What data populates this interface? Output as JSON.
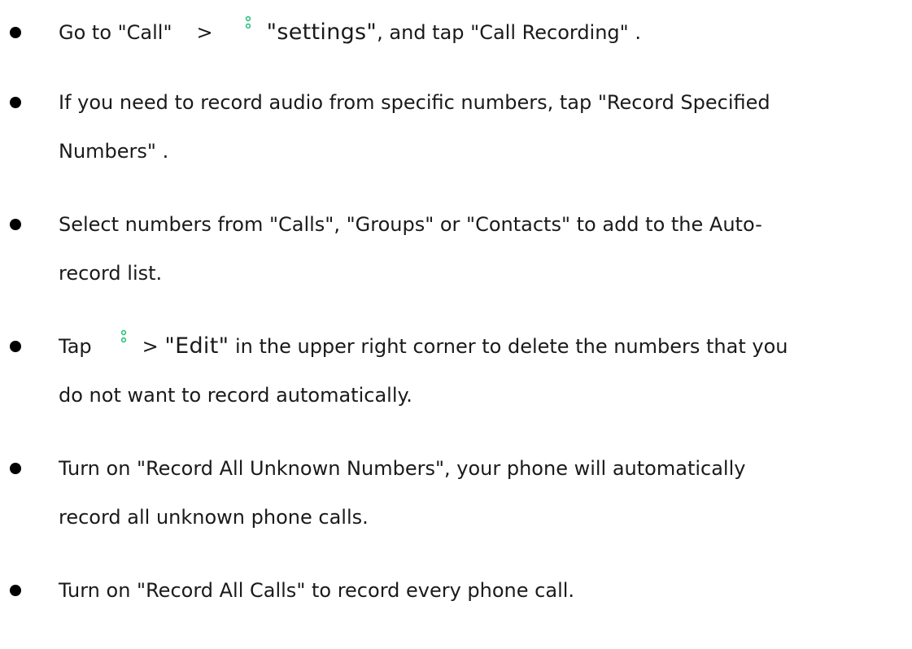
{
  "items": [
    {
      "lines": [
        {
          "parts": {
            "a": "Go to \"Call\"",
            "b": ">",
            "c": "\"settings\"",
            "d": ", and tap \"Call Recording\" ."
          }
        }
      ]
    },
    {
      "lines": [
        {
          "text": "If you need to record audio from specific numbers, tap \"Record Specified"
        },
        {
          "text": "Numbers\" ."
        }
      ]
    },
    {
      "lines": [
        {
          "text": "Select numbers from \"Calls\", \"Groups\" or \"Contacts\" to add to the Auto-"
        },
        {
          "text": "record list."
        }
      ]
    },
    {
      "lines": [
        {
          "parts": {
            "a": "Tap",
            "b": ">",
            "c": "\"Edit\"",
            "d": " in the upper right corner to delete the numbers that you"
          }
        },
        {
          "text": "do not want to record automatically."
        }
      ]
    },
    {
      "lines": [
        {
          "text": "Turn on \"Record All Unknown Numbers\", your phone will automatically"
        },
        {
          "text": "record all unknown phone calls."
        }
      ]
    },
    {
      "lines": [
        {
          "text": "Turn on \"Record All Calls\" to record every phone call."
        }
      ]
    }
  ],
  "icons": {
    "more": "more-vertical-dots-icon",
    "more_color": "#2ec27e"
  },
  "colors": {
    "text": "#1a1a1a",
    "bullet": "#000000"
  }
}
